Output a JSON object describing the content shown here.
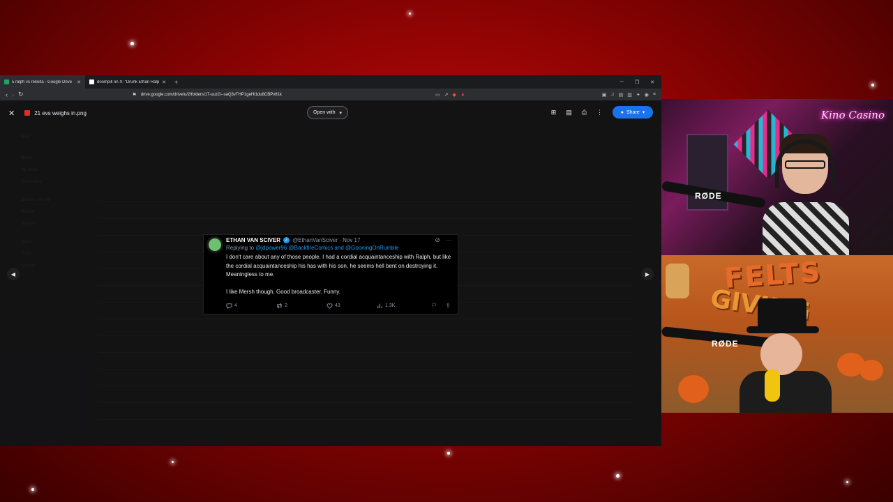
{
  "browser": {
    "tabs": [
      {
        "title": "5 ralph vs rekeita - Google Drive",
        "active": true,
        "favicon_color": "#1fa463"
      },
      {
        "title": "doompill on X: \"Drunk Ethan Ralph i",
        "active": false,
        "favicon_color": "#ffffff"
      }
    ],
    "url": "drive.google.com/drive/u/2/folders/17-uuzG--saQ3vTHP1geHi1du8CBPv81k"
  },
  "viewer": {
    "file_name": "21 evs weighs in.png",
    "open_with_label": "Open with",
    "share_label": "Share"
  },
  "tweet": {
    "author_name": "ETHAN VAN SCIVER",
    "handle_date": "@EthanVanSciver · Nov 17",
    "replying_to_prefix": "Replying to",
    "replying_to_links": "@jdpower96 @BackfireComics and @GooningOnRumble",
    "body": "I don't care about any of those people.  I had a cordial acquaintanceship with Ralph, but like the cordial acquaintanceship his has with his son, he seems hell bent on destroying it.  Meaningless to me.\n\nI like Mersh though.  Good broadcaster.  Funny.",
    "replies": "4",
    "reposts": "2",
    "likes": "43",
    "views": "1.3K"
  },
  "overlay": {
    "brand": "Kino Casino",
    "mic_label_1": "RØDE",
    "mic_label_2": "RØDE",
    "banner_1": "FELTS",
    "banner_2": "GIVING"
  },
  "colors": {
    "background_red": "#c40b0b",
    "share_blue": "#1a73e8",
    "link_blue": "#1d9bf0"
  }
}
